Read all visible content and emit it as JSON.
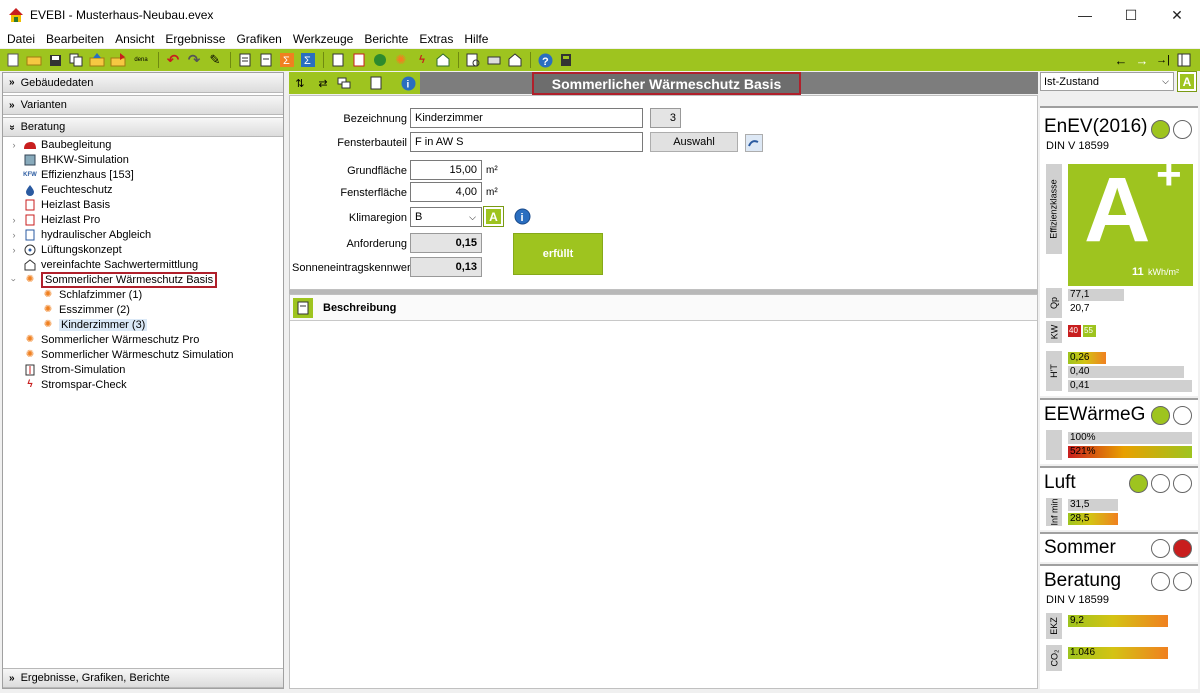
{
  "window": {
    "title": "EVEBI - Musterhaus-Neubau.evex",
    "minimize": "—",
    "maximize": "☐",
    "close": "✕"
  },
  "menu": [
    "Datei",
    "Bearbeiten",
    "Ansicht",
    "Ergebnisse",
    "Grafiken",
    "Werkzeuge",
    "Berichte",
    "Extras",
    "Hilfe"
  ],
  "toolbar": {
    "dena_label": "dena"
  },
  "left": {
    "sections": {
      "gebaeudedaten": "Gebäudedaten",
      "varianten": "Varianten",
      "beratung": "Beratung",
      "ergebnisse": "Ergebnisse, Grafiken, Berichte"
    },
    "tree": [
      {
        "label": "Baubegleitung",
        "icon": "helmet-icon"
      },
      {
        "label": "BHKW-Simulation",
        "icon": "chp-icon"
      },
      {
        "label": "Effizienzhaus [153]",
        "icon": "kfw-icon",
        "icon_text": "KFW"
      },
      {
        "label": "Feuchteschutz",
        "icon": "drop-icon"
      },
      {
        "label": "Heizlast Basis",
        "icon": "heat-load-icon"
      },
      {
        "label": "Heizlast Pro",
        "icon": "heat-load-icon"
      },
      {
        "label": "hydraulischer Abgleich",
        "icon": "hydraulic-icon"
      },
      {
        "label": "Lüftungskonzept",
        "icon": "fan-icon"
      },
      {
        "label": "vereinfachte Sachwertermittlung",
        "icon": "house-euro-icon"
      },
      {
        "label": "Sommerlicher Wärmeschutz Basis",
        "icon": "sun-icon"
      },
      {
        "label": "Schlafzimmer (1)",
        "icon": "sun-icon"
      },
      {
        "label": "Esszimmer (2)",
        "icon": "sun-icon"
      },
      {
        "label": "Kinderzimmer (3)",
        "icon": "sun-icon"
      },
      {
        "label": "Sommerlicher Wärmeschutz Pro",
        "icon": "sun-icon"
      },
      {
        "label": "Sommerlicher Wärmeschutz Simulation",
        "icon": "sun-icon"
      },
      {
        "label": "Strom-Simulation",
        "icon": "power-icon"
      },
      {
        "label": "Stromspar-Check",
        "icon": "lightning-icon"
      }
    ]
  },
  "page_title": "Sommerlicher Wärmeschutz Basis",
  "form": {
    "bezeichnung_label": "Bezeichnung",
    "bezeichnung_value": "Kinderzimmer",
    "nummer": "3",
    "fensterbauteil_label": "Fensterbauteil",
    "fensterbauteil_value": "F in AW S",
    "auswahl_button": "Auswahl",
    "grundflaeche_label": "Grundfläche",
    "grundflaeche_value": "15,00",
    "fensterflaeche_label": "Fensterfläche",
    "fensterflaeche_value": "4,00",
    "unit_m2": "m²",
    "klimaregion_label": "Klimaregion",
    "klimaregion_value": "B",
    "a_badge": "A",
    "info_icon": "i",
    "anforderung_label": "Anforderung",
    "anforderung_value": "0,15",
    "sonnen_label": "Sonneneintragskennwert",
    "sonnen_value": "0,13",
    "status": "erfüllt"
  },
  "beschreibung": {
    "title": "Beschreibung"
  },
  "right": {
    "zustand": "Ist-Zustand",
    "a_button": "A",
    "enev": {
      "title": "EnEV(2016)",
      "sub": "DIN V 18599",
      "class_label": "Effizienzklasse",
      "class": "A",
      "plus": "+",
      "value": "11",
      "unit": "kWh/m²",
      "qp_label": "Qp",
      "qp_values": [
        "77,1",
        "20,7"
      ],
      "kw_label": "KW",
      "kw_values": [
        "40",
        "55"
      ],
      "ht_label": "H'T",
      "ht_values": [
        "0,26",
        "0,40",
        "0,41"
      ]
    },
    "eewaerme": {
      "title": "EEWärmeG",
      "values": [
        "100%",
        "521%"
      ]
    },
    "luft": {
      "title": "Luft",
      "label": "Inf min",
      "values": [
        "31,5",
        "28,5"
      ]
    },
    "sommer": {
      "title": "Sommer"
    },
    "beratung": {
      "title": "Beratung",
      "sub": "DIN V 18599",
      "ekz_label": "EKZ",
      "ekz_value": "9,2",
      "co2_label": "CO₂",
      "co2_value": "1.046"
    },
    "colors": {
      "green": "#9ec41f",
      "red": "#c81e1e"
    }
  }
}
